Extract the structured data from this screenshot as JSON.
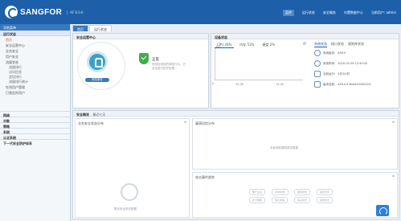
{
  "header": {
    "brand": "SANGFOR",
    "brand_sub": "AF 8.0.6",
    "nav": [
      "监控",
      "运行状态",
      "安全服务",
      "内置数据中心",
      "当前用户: admin"
    ]
  },
  "sidebar": {
    "title": "导航菜单",
    "group_main": "运行状态",
    "items": [
      "首页",
      "安全运营中心",
      "业务安全",
      "用户安全"
    ],
    "group_sub": "流量状态",
    "sub_items": [
      "流量排行",
      "访问信息",
      "会话排行",
      "流量排行统计"
    ],
    "items2": [
      "在线用户管理",
      "已锁定的用户"
    ],
    "collapsed": [
      "网络",
      "对象",
      "策略",
      "系统",
      "认证系统",
      "下一代安全防护体系"
    ]
  },
  "tabs": [
    "首页",
    "运行状态"
  ],
  "security_center": {
    "title": "安全运营中心",
    "badge": "风险事件",
    "status": "正常",
    "desc": "系统检测到的风险行为，已自动进行防护处理..."
  },
  "device_status": {
    "title": "设备状态",
    "tabs": [
      "CPU 26%",
      "内存 53%",
      "硬盘 2%"
    ],
    "y_top": "100",
    "y_bottom": "0",
    "x_labels": [
      "15:30",
      "15:45"
    ],
    "detail_tabs": [
      "系统状态",
      "接口状态",
      "规则库状态"
    ],
    "items": [
      {
        "label": "系统版本:",
        "value": "AF8.0"
      },
      {
        "label": "系统时间:",
        "value": "2020-02-09 12:40:42"
      },
      {
        "label": "当前运行:",
        "value": "5天3小时"
      },
      {
        "label": "版本信息:",
        "value": "AF8.0.6 Build20200224"
      }
    ]
  },
  "overview": {
    "title": "安全概览",
    "range": "最近七天",
    "panel_left": "业务安全状态分布",
    "panel_right_top": "漏洞风险分布",
    "panel_right_top_empty": "未检测到漏洞风险数据",
    "panel_right_bottom": "攻击事件趋势",
    "panel_left_empty": "暂无安全状态数据",
    "pills": [
      "僵尸主机",
      "WEB攻击",
      "漏洞攻击",
      "恶意文件",
      "暴力破解",
      "信息泄露",
      "病毒攻击",
      "其他攻击"
    ]
  },
  "colors": {
    "brand": "#1d5fa8",
    "safe": "#3fae49",
    "accent": "#3ba0c8"
  }
}
